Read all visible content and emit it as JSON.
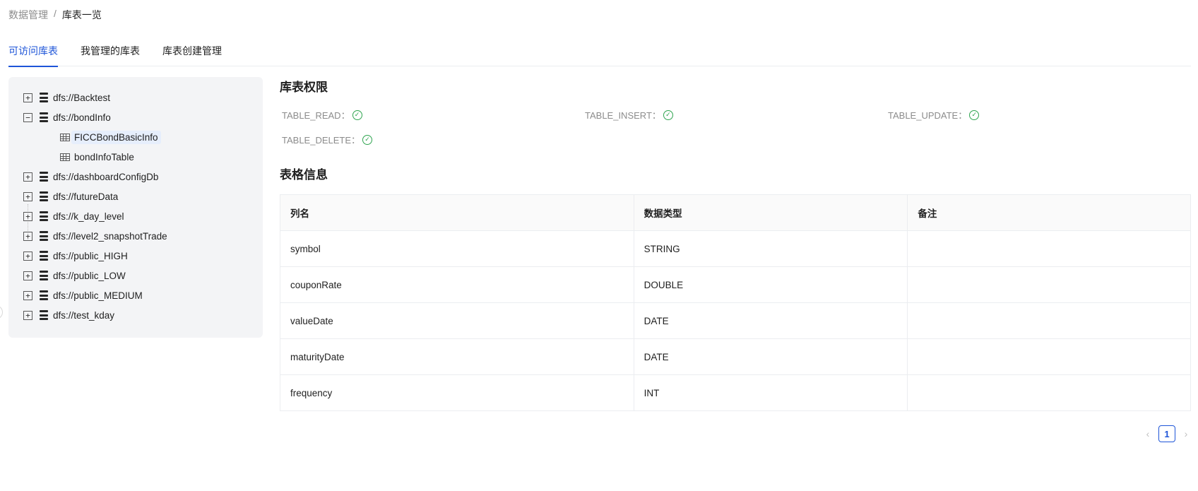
{
  "breadcrumb": {
    "parent": "数据管理",
    "separator": "/",
    "current": "库表一览"
  },
  "tabs": [
    {
      "label": "可访问库表",
      "active": true
    },
    {
      "label": "我管理的库表",
      "active": false
    },
    {
      "label": "库表创建管理",
      "active": false
    }
  ],
  "tree": {
    "nodes": [
      {
        "label": "dfs://Backtest",
        "expanded": false
      },
      {
        "label": "dfs://bondInfo",
        "expanded": true,
        "children": [
          {
            "label": "FICCBondBasicInfo",
            "selected": true
          },
          {
            "label": "bondInfoTable",
            "selected": false
          }
        ]
      },
      {
        "label": "dfs://dashboardConfigDb",
        "expanded": false
      },
      {
        "label": "dfs://futureData",
        "expanded": false
      },
      {
        "label": "dfs://k_day_level",
        "expanded": false
      },
      {
        "label": "dfs://level2_snapshotTrade",
        "expanded": false
      },
      {
        "label": "dfs://public_HIGH",
        "expanded": false
      },
      {
        "label": "dfs://public_LOW",
        "expanded": false
      },
      {
        "label": "dfs://public_MEDIUM",
        "expanded": false
      },
      {
        "label": "dfs://test_kday",
        "expanded": false
      }
    ],
    "expand_symbol": "+",
    "collapse_symbol": "−"
  },
  "permissions": {
    "title": "库表权限",
    "items": [
      {
        "label": "TABLE_READ：",
        "granted": true
      },
      {
        "label": "TABLE_INSERT：",
        "granted": true
      },
      {
        "label": "TABLE_UPDATE：",
        "granted": true
      },
      {
        "label": "TABLE_DELETE：",
        "granted": true
      }
    ],
    "check_glyph": "✓",
    "check_color": "#2ea44f"
  },
  "table_info": {
    "title": "表格信息",
    "headers": [
      "列名",
      "数据类型",
      "备注"
    ],
    "rows": [
      [
        "symbol",
        "STRING",
        ""
      ],
      [
        "couponRate",
        "DOUBLE",
        ""
      ],
      [
        "valueDate",
        "DATE",
        ""
      ],
      [
        "maturityDate",
        "DATE",
        ""
      ],
      [
        "frequency",
        "INT",
        ""
      ]
    ]
  },
  "pagination": {
    "prev": "‹",
    "current_page": "1",
    "next": "›"
  },
  "colors": {
    "accent": "#1e55d8",
    "panel_bg": "#f3f4f6"
  }
}
